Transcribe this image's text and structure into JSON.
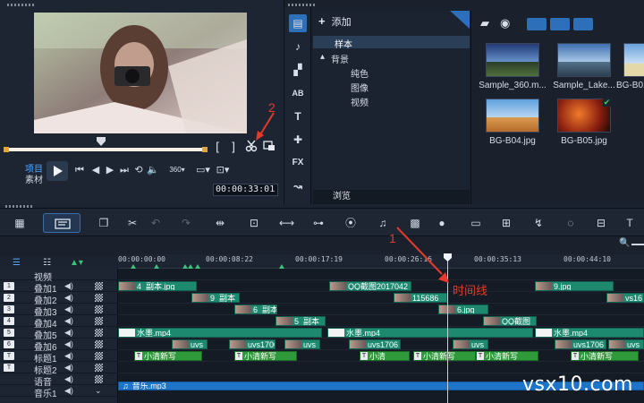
{
  "player": {
    "mode_project": "项目",
    "mode_clip": "素材",
    "timecode": "00:00:33:01",
    "annotation_2": "2",
    "mark_in": "[",
    "mark_out": "]"
  },
  "library": {
    "add_label": "添加",
    "tree": {
      "sample": "样本",
      "background": "背景",
      "solid_color": "纯色",
      "image": "图像",
      "video": "视频"
    },
    "browse_label": "浏览",
    "thumbs": [
      {
        "label": "Sample_360.m..."
      },
      {
        "label": "Sample_Lake..."
      },
      {
        "label": "BG-B01.j"
      },
      {
        "label": "BG-B04.jpg"
      },
      {
        "label": "BG-B05.jpg"
      }
    ],
    "tools": [
      "media",
      "instant",
      "transition",
      "title-ab",
      "title",
      "graphic",
      "fx",
      "path"
    ]
  },
  "timeline": {
    "ruler_ticks": [
      "00:00:00:00",
      "00:00:08:22",
      "00:00:17:19",
      "00:00:26:16",
      "00:00:35:13",
      "00:00:44:10"
    ],
    "annotation_1": "1",
    "playhead_label": "时间线",
    "tracks": [
      {
        "num": "",
        "name": "视频"
      },
      {
        "num": "1",
        "name": "叠加1"
      },
      {
        "num": "2",
        "name": "叠加2"
      },
      {
        "num": "3",
        "name": "叠加3"
      },
      {
        "num": "4",
        "name": "叠加4"
      },
      {
        "num": "5",
        "name": "叠加5"
      },
      {
        "num": "6",
        "name": "叠加6"
      },
      {
        "num": "T",
        "name": "标题1"
      },
      {
        "num": "T",
        "name": "标题2"
      },
      {
        "num": "",
        "name": "语音"
      },
      {
        "num": "",
        "name": "音乐1"
      }
    ],
    "clips": {
      "c1": "4_副本.jpg",
      "c2": "QQ截图2017042",
      "c3": "9.jpg",
      "c4": "9_副本",
      "c5": "115686",
      "c6": "vs16",
      "c7": "6_副本",
      "c8": "6.jpg",
      "c9": "5_副本",
      "c10": "QQ截图",
      "c11": "水墨.mp4",
      "c12": "水墨.mp4",
      "c13": "水墨.mp4",
      "c14": "uvs",
      "c15": "uvs1706",
      "c16": "uvs1706",
      "c17": "uvs",
      "c18": "uvs",
      "c19": "uvs1706",
      "c20": "uvs",
      "c21": "小清新写",
      "c22": "小清新写",
      "c23": "小清",
      "c24": "小清新写",
      "c25": "小清新写",
      "c26": "小清新写",
      "music": "音乐.mp3",
      "t_icon": "T"
    }
  },
  "watermark": "vsx10.com",
  "colors": {
    "accent": "#3a6ea8",
    "clip_video": "#1d8a70",
    "clip_title": "#2e9a3a",
    "clip_music": "#1d74c8",
    "annotation": "#e53a2c"
  }
}
